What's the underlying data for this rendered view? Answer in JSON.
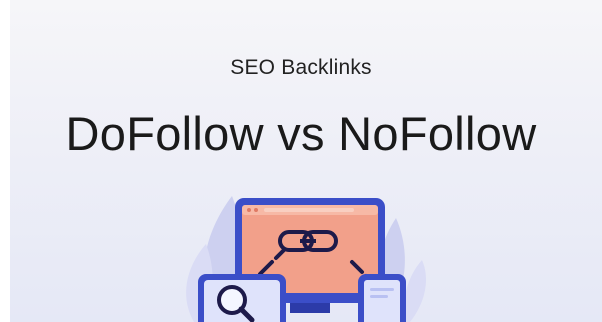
{
  "header": {
    "subtitle": "SEO Backlinks",
    "title": "DoFollow vs NoFollow"
  },
  "illustration": {
    "icons": [
      "monitor-icon",
      "chain-link-icon",
      "magnifier-icon",
      "phone-icon",
      "leaf-icon"
    ]
  },
  "colors": {
    "background_top": "#f6f6f9",
    "background_bottom": "#e5e8f6",
    "monitor_frame": "#3b4ec8",
    "monitor_screen": "#f2a08a",
    "accent_dark": "#1d1a4a",
    "leaf": "#c9cbef"
  }
}
